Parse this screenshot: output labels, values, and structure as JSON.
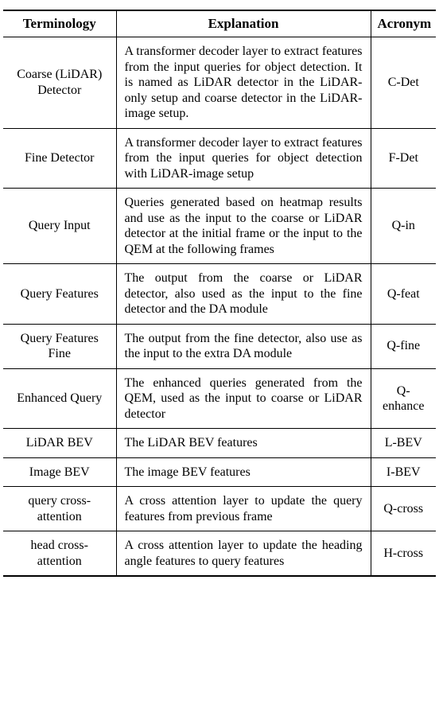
{
  "headers": {
    "terminology": "Terminology",
    "explanation": "Explanation",
    "acronym": "Acronym"
  },
  "rows": [
    {
      "term": "Coarse (LiDAR) Detector",
      "expl": "A transformer decoder layer to ex­tract features from the input queries for object detection. It is named as LiDAR detector in the LiDAR-only setup and coarse detector in the LiDAR-image setup.",
      "acr": "C-Det"
    },
    {
      "term": "Fine Detector",
      "expl": "A transformer decoder layer to ex­tract features from the input queries for object detection with LiDAR-image setup",
      "acr": "F-Det"
    },
    {
      "term": "Query Input",
      "expl": "Queries generated based on heatmap results and use as the input to the coarse or LiDAR detector at the initial frame or the input to the QEM at the following frames",
      "acr": "Q-in"
    },
    {
      "term": "Query Features",
      "expl": "The output from the coarse or Li­DAR detector, also used as the in­put to the fine detector and the DA module",
      "acr": "Q-feat"
    },
    {
      "term": "Query Features Fine",
      "expl": "The output from the fine detector, also use as the input to the extra DA module",
      "acr": "Q-fine"
    },
    {
      "term": "Enhanced Query",
      "expl": "The enhanced queries generated from the QEM, used as the input to coarse or LiDAR detector",
      "acr": "Q-enhance"
    },
    {
      "term": "LiDAR BEV",
      "expl": "The LiDAR BEV features",
      "acr": "L-BEV"
    },
    {
      "term": "Image BEV",
      "expl": "The image BEV features",
      "acr": "I-BEV"
    },
    {
      "term": "query cross-attention",
      "expl": "A cross attention layer to update the query features from previous frame",
      "acr": "Q-cross"
    },
    {
      "term": "head cross-attention",
      "expl": "A cross attention layer to update the heading angle features to query fea­tures",
      "acr": "H-cross"
    }
  ]
}
